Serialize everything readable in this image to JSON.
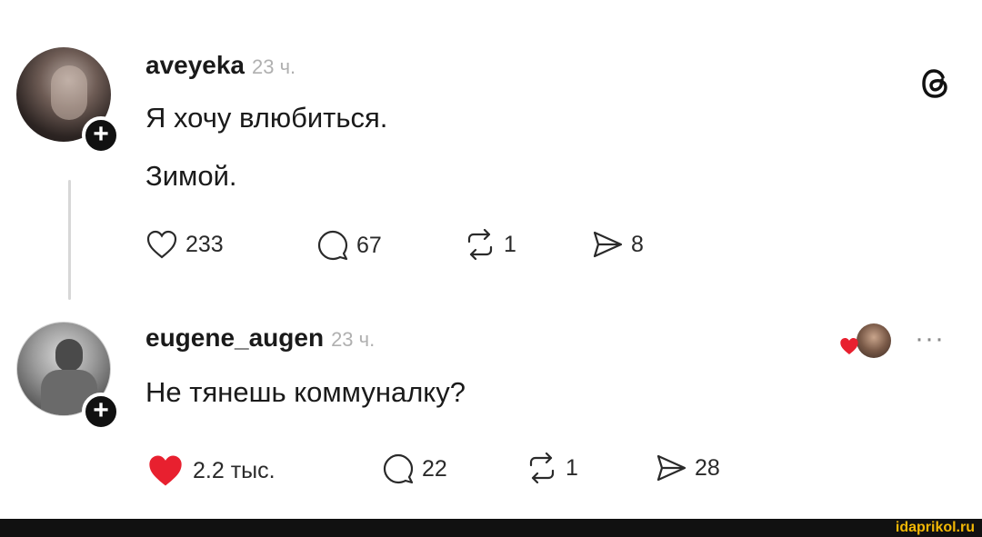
{
  "posts": [
    {
      "username": "aveyeka",
      "time": "23 ч.",
      "lines": [
        "Я хочу влюбиться.",
        "Зимой."
      ],
      "likes": "233",
      "replies": "67",
      "reposts": "1",
      "shares": "8"
    },
    {
      "username": "eugene_augen",
      "time": "23 ч.",
      "lines": [
        "Не тянешь коммуналку?"
      ],
      "likes": "2.2 тыс.",
      "replies": "22",
      "reposts": "1",
      "shares": "28"
    }
  ],
  "plus_label": "+",
  "more_label": "···",
  "watermark": "idaprikol.ru",
  "colors": {
    "like_red": "#e8202f",
    "footer": "#111111",
    "watermark": "#f2b705"
  },
  "icons": [
    "threads-logo-icon",
    "heart-icon",
    "comment-icon",
    "repost-icon",
    "share-icon",
    "more-icon"
  ]
}
